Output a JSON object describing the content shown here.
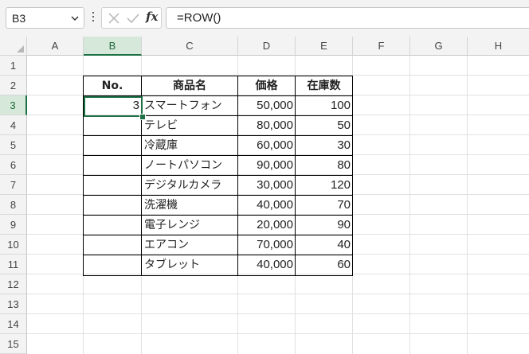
{
  "formula_bar": {
    "name_box": "B3",
    "formula": "=ROW()",
    "fx_label": "fx"
  },
  "columns": [
    "A",
    "B",
    "C",
    "D",
    "E",
    "F",
    "G",
    "H"
  ],
  "rows": [
    "1",
    "2",
    "3",
    "4",
    "5",
    "6",
    "7",
    "8",
    "9",
    "10",
    "11",
    "12",
    "13",
    "14",
    "15"
  ],
  "selected_cell": "B3",
  "table": {
    "headers": [
      "No.",
      "商品名",
      "価格",
      "在庫数"
    ],
    "rows": [
      {
        "no": "3",
        "name": "スマートフォン",
        "price": "50,000",
        "stock": "100"
      },
      {
        "no": "",
        "name": "テレビ",
        "price": "80,000",
        "stock": "50"
      },
      {
        "no": "",
        "name": "冷蔵庫",
        "price": "60,000",
        "stock": "30"
      },
      {
        "no": "",
        "name": "ノートパソコン",
        "price": "90,000",
        "stock": "80"
      },
      {
        "no": "",
        "name": "デジタルカメラ",
        "price": "30,000",
        "stock": "120"
      },
      {
        "no": "",
        "name": "洗濯機",
        "price": "40,000",
        "stock": "70"
      },
      {
        "no": "",
        "name": "電子レンジ",
        "price": "20,000",
        "stock": "90"
      },
      {
        "no": "",
        "name": "エアコン",
        "price": "70,000",
        "stock": "40"
      },
      {
        "no": "",
        "name": "タブレット",
        "price": "40,000",
        "stock": "60"
      }
    ]
  },
  "colors": {
    "selection": "#1e7145",
    "header_bg": "#f3f3f3",
    "selected_header_bg": "#d6e8d9"
  }
}
